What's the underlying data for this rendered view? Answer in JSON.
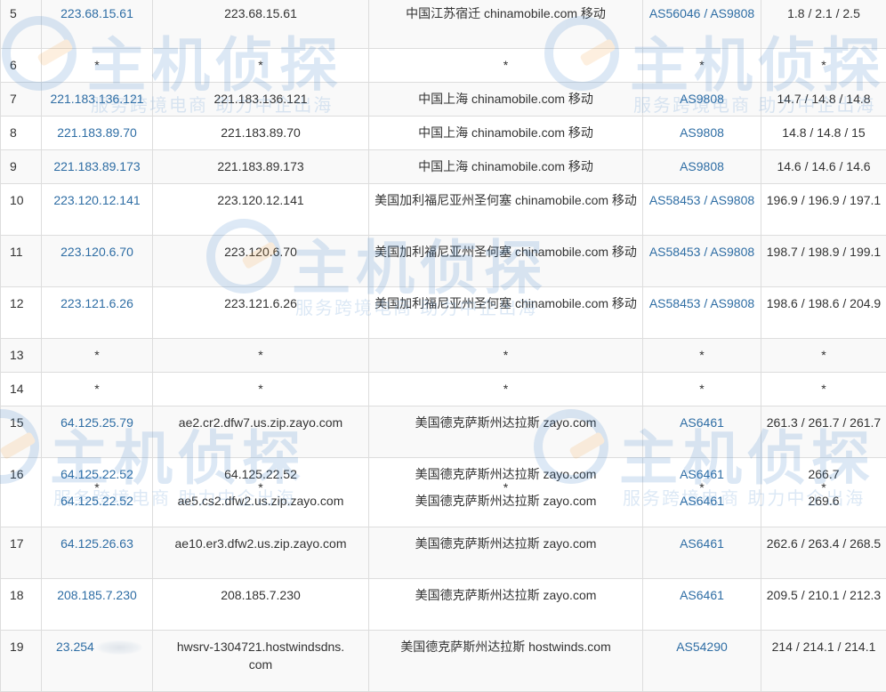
{
  "watermark": {
    "brand": "主机侦探",
    "slogan": "服务跨境电商 助力中企出海"
  },
  "rows": [
    {
      "hop": "5",
      "ip": "223.68.15.61",
      "host": "223.68.15.61",
      "loc": "中国江苏宿迁 chinamobile.com 移动",
      "asn": "AS56046 / AS9808",
      "rtt": "1.8 / 2.1 / 2.5"
    },
    {
      "hop": "6",
      "ip": "*",
      "host": "*",
      "loc": "*",
      "asn": "*",
      "rtt": "*"
    },
    {
      "hop": "7",
      "ip": "221.183.136.121",
      "host": "221.183.136.121",
      "loc": "中国上海 chinamobile.com 移动",
      "asn": "AS9808",
      "rtt": "14.7 / 14.8 / 14.8"
    },
    {
      "hop": "8",
      "ip": "221.183.89.70",
      "host": "221.183.89.70",
      "loc": "中国上海 chinamobile.com 移动",
      "asn": "AS9808",
      "rtt": "14.8 / 14.8 / 15"
    },
    {
      "hop": "9",
      "ip": "221.183.89.173",
      "host": "221.183.89.173",
      "loc": "中国上海 chinamobile.com 移动",
      "asn": "AS9808",
      "rtt": "14.6 / 14.6 / 14.6"
    },
    {
      "hop": "10",
      "ip": "223.120.12.141",
      "host": "223.120.12.141",
      "loc": "美国加利福尼亚州圣何塞 chinamobile.com 移动",
      "asn": "AS58453 / AS9808",
      "rtt": "196.9 / 196.9 / 197.1"
    },
    {
      "hop": "11",
      "ip": "223.120.6.70",
      "host": "223.120.6.70",
      "loc": "美国加利福尼亚州圣何塞 chinamobile.com 移动",
      "asn": "AS58453 / AS9808",
      "rtt": "198.7 / 198.9 / 199.1"
    },
    {
      "hop": "12",
      "ip": "223.121.6.26",
      "host": "223.121.6.26",
      "loc": "美国加利福尼亚州圣何塞 chinamobile.com 移动",
      "asn": "AS58453 / AS9808",
      "rtt": "198.6 / 198.6 / 204.9"
    },
    {
      "hop": "13",
      "ip": "*",
      "host": "*",
      "loc": "*",
      "asn": "*",
      "rtt": "*"
    },
    {
      "hop": "14",
      "ip": "*",
      "host": "*",
      "loc": "*",
      "asn": "*",
      "rtt": "*"
    },
    {
      "hop": "15",
      "ip": "64.125.25.79",
      "host": "ae2.cr2.dfw7.us.zip.zayo.com",
      "loc": "美国德克萨斯州达拉斯 zayo.com",
      "asn": "AS6461",
      "rtt": "261.3 / 261.7 / 261.7"
    },
    {
      "hop": "16",
      "ip": "64.125.22.52",
      "host": "64.125.22.52",
      "loc": "美国德克萨斯州达拉斯 zayo.com",
      "asn": "AS6461",
      "rtt": "266.7",
      "sub": [
        {
          "ip": "*",
          "host": "*",
          "loc": "*",
          "asn": "*",
          "rtt": "*"
        },
        {
          "ip": "64.125.22.52",
          "host": "ae5.cs2.dfw2.us.zip.zayo.com",
          "loc": "美国德克萨斯州达拉斯 zayo.com",
          "asn": "AS6461",
          "rtt": "269.6"
        }
      ]
    },
    {
      "hop": "17",
      "ip": "64.125.26.63",
      "host": "ae10.er3.dfw2.us.zip.zayo.com",
      "loc": "美国德克萨斯州达拉斯 zayo.com",
      "asn": "AS6461",
      "rtt": "262.6 / 263.4 / 268.5"
    },
    {
      "hop": "18",
      "ip": "208.185.7.230",
      "host": "208.185.7.230",
      "loc": "美国德克萨斯州达拉斯 zayo.com",
      "asn": "AS6461",
      "rtt": "209.5 / 210.1 / 212.3"
    },
    {
      "hop": "19",
      "ip": "23.254",
      "host": "hwsrv-1304721.hostwindsdns.com",
      "loc": "美国德克萨斯州达拉斯 hostwinds.com",
      "asn": "AS54290",
      "rtt": "214 / 214.1 / 214.1"
    }
  ]
}
